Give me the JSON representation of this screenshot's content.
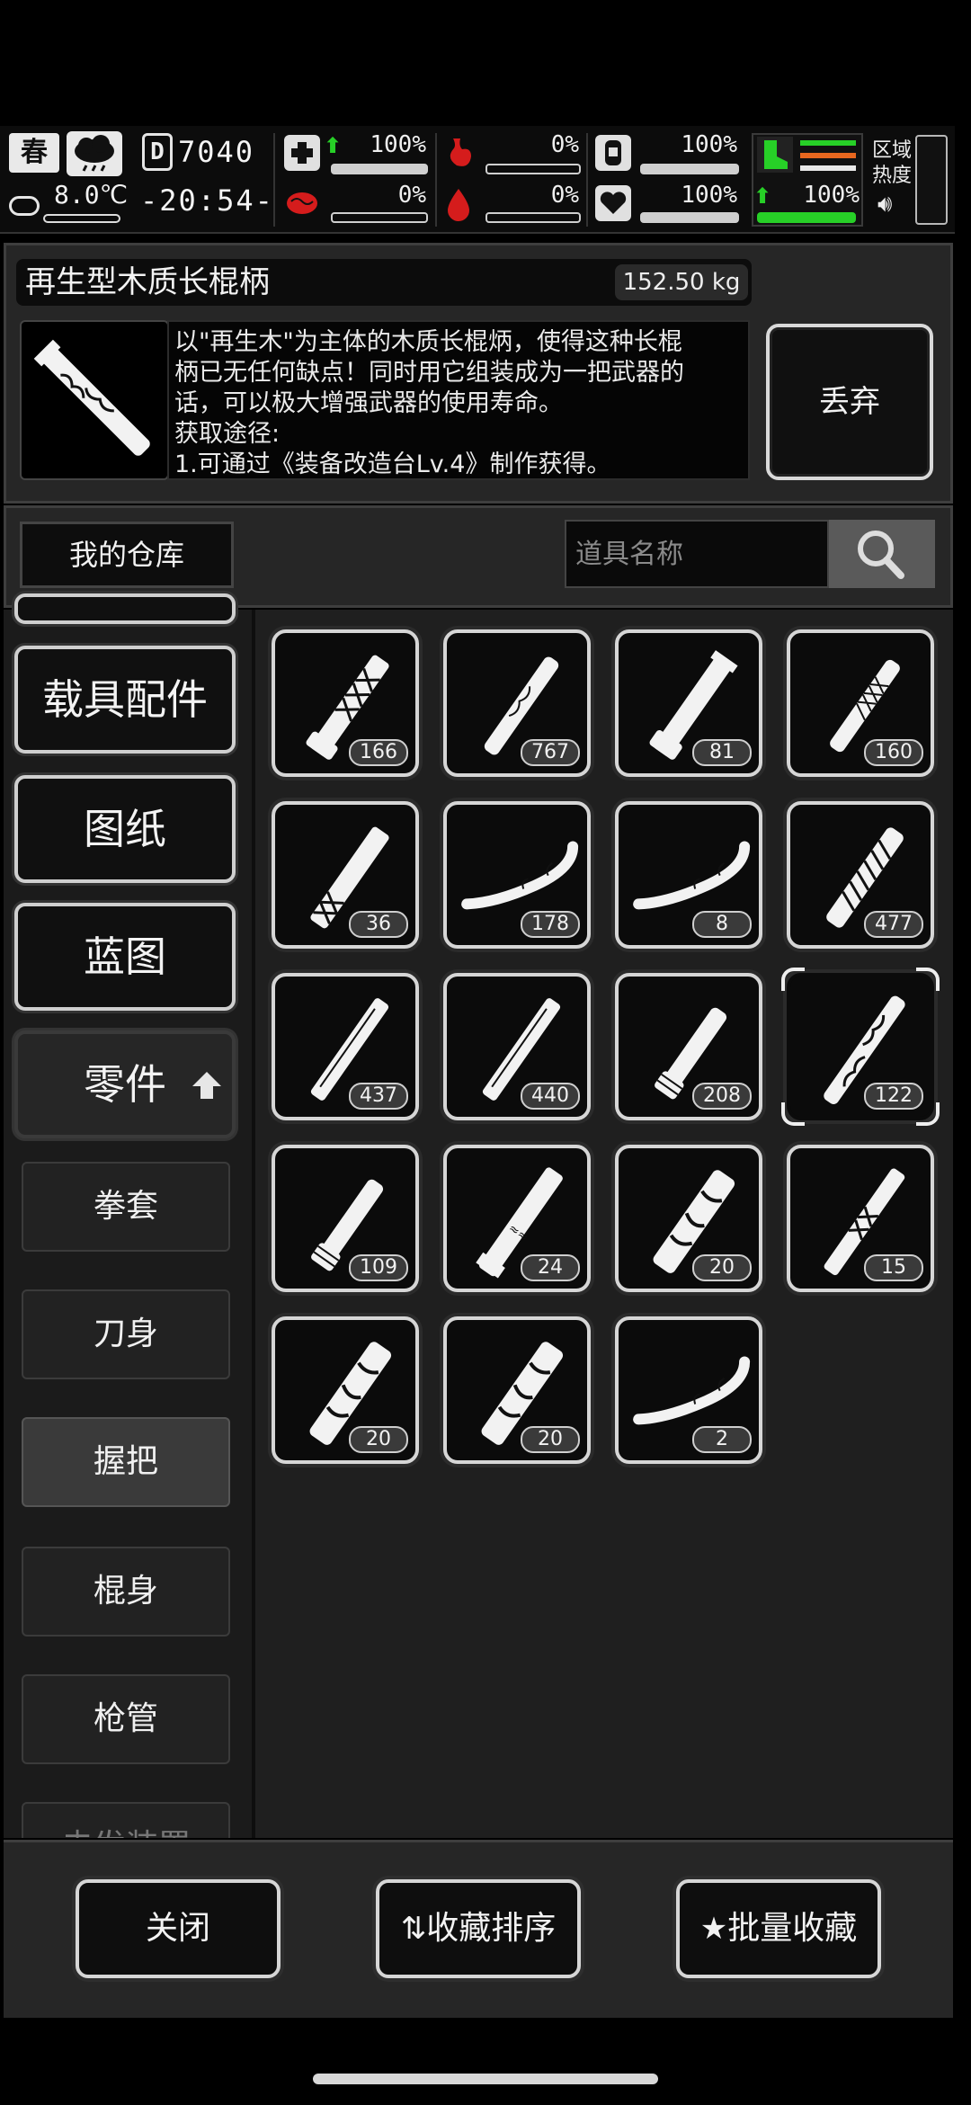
{
  "status": {
    "season": "春",
    "temperature": "8.0℃",
    "day": "7040",
    "day_icon": "D",
    "time": "-20:54-",
    "stats": [
      {
        "name": "health",
        "value": "100%",
        "up": true
      },
      {
        "name": "hunger",
        "value": "0%"
      },
      {
        "name": "water",
        "value": "100%"
      },
      {
        "name": "mental",
        "value": "0%"
      },
      {
        "name": "blood",
        "value": "0%"
      },
      {
        "name": "heart",
        "value": "100%"
      }
    ],
    "stamina": "100%",
    "region_label_1": "区域",
    "region_label_2": "热度",
    "colors": {
      "green": "#27d027",
      "orange": "#e8671f",
      "red": "#d51c1c"
    }
  },
  "item": {
    "name": "再生型木质长棍柄",
    "weight": "152.50 kg",
    "description": "以\"再生木\"为主体的木质长棍炳，使得这种长棍\n柄已无任何缺点！同时用它组装成为一把武器的\n话，可以极大增强武器的使用寿命。\n获取途径:\n1.可通过《装备改造台Lv.4》制作获得。",
    "discard_label": "丢弃"
  },
  "warehouse": {
    "label": "我的仓库",
    "search_placeholder": "道具名称"
  },
  "categories": [
    {
      "label": "载具配件"
    },
    {
      "label": "图纸"
    },
    {
      "label": "蓝图"
    },
    {
      "label": "零件",
      "active": true
    }
  ],
  "subcategories": [
    {
      "label": "拳套"
    },
    {
      "label": "刀身"
    },
    {
      "label": "握把",
      "active": true
    },
    {
      "label": "棍身"
    },
    {
      "label": "枪管"
    },
    {
      "label": "击发装置"
    }
  ],
  "items": [
    {
      "count": "166",
      "icon": "handle-wrapped-icon"
    },
    {
      "count": "767",
      "icon": "handle-slim-icon"
    },
    {
      "count": "81",
      "icon": "handle-plain-icon"
    },
    {
      "count": "160",
      "icon": "handle-braided-icon"
    },
    {
      "count": "36",
      "icon": "handle-net-icon"
    },
    {
      "count": "178",
      "icon": "handle-curved-icon"
    },
    {
      "count": "8",
      "icon": "handle-curved-icon"
    },
    {
      "count": "477",
      "icon": "handle-grip-icon"
    },
    {
      "count": "437",
      "icon": "handle-long-icon"
    },
    {
      "count": "440",
      "icon": "handle-long-icon"
    },
    {
      "count": "208",
      "icon": "handle-short-icon"
    },
    {
      "count": "122",
      "icon": "handle-wood-icon",
      "selected": true
    },
    {
      "count": "109",
      "icon": "handle-short-icon"
    },
    {
      "count": "24",
      "icon": "handle-engraved-icon"
    },
    {
      "count": "20",
      "icon": "handle-marble-icon"
    },
    {
      "count": "15",
      "icon": "handle-cross-icon"
    },
    {
      "count": "20",
      "icon": "handle-marble-icon"
    },
    {
      "count": "20",
      "icon": "handle-marble-icon"
    },
    {
      "count": "2",
      "icon": "handle-curved-icon"
    }
  ],
  "bottom": {
    "close_label": "关闭",
    "sort_label": "收藏排序",
    "batch_label": "批量收藏"
  }
}
